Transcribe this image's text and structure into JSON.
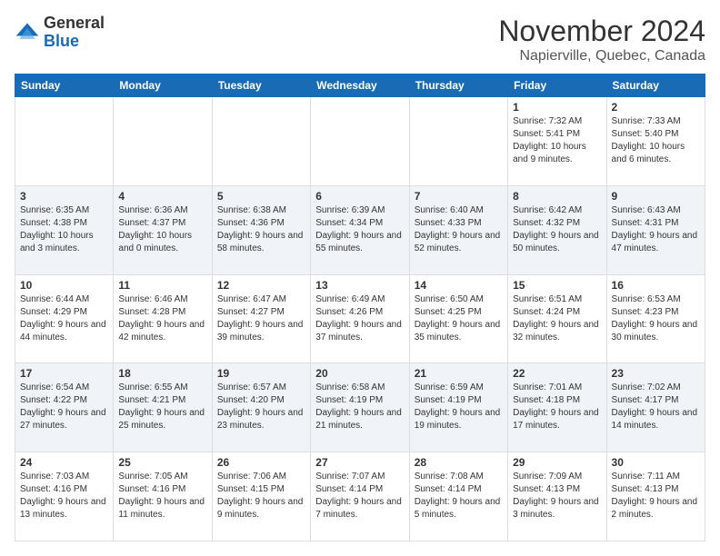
{
  "header": {
    "logo_line1": "General",
    "logo_line2": "Blue",
    "month_title": "November 2024",
    "location": "Napierville, Quebec, Canada"
  },
  "days_of_week": [
    "Sunday",
    "Monday",
    "Tuesday",
    "Wednesday",
    "Thursday",
    "Friday",
    "Saturday"
  ],
  "weeks": [
    [
      {
        "day": "",
        "info": ""
      },
      {
        "day": "",
        "info": ""
      },
      {
        "day": "",
        "info": ""
      },
      {
        "day": "",
        "info": ""
      },
      {
        "day": "",
        "info": ""
      },
      {
        "day": "1",
        "info": "Sunrise: 7:32 AM\nSunset: 5:41 PM\nDaylight: 10 hours and 9 minutes."
      },
      {
        "day": "2",
        "info": "Sunrise: 7:33 AM\nSunset: 5:40 PM\nDaylight: 10 hours and 6 minutes."
      }
    ],
    [
      {
        "day": "3",
        "info": "Sunrise: 6:35 AM\nSunset: 4:38 PM\nDaylight: 10 hours and 3 minutes."
      },
      {
        "day": "4",
        "info": "Sunrise: 6:36 AM\nSunset: 4:37 PM\nDaylight: 10 hours and 0 minutes."
      },
      {
        "day": "5",
        "info": "Sunrise: 6:38 AM\nSunset: 4:36 PM\nDaylight: 9 hours and 58 minutes."
      },
      {
        "day": "6",
        "info": "Sunrise: 6:39 AM\nSunset: 4:34 PM\nDaylight: 9 hours and 55 minutes."
      },
      {
        "day": "7",
        "info": "Sunrise: 6:40 AM\nSunset: 4:33 PM\nDaylight: 9 hours and 52 minutes."
      },
      {
        "day": "8",
        "info": "Sunrise: 6:42 AM\nSunset: 4:32 PM\nDaylight: 9 hours and 50 minutes."
      },
      {
        "day": "9",
        "info": "Sunrise: 6:43 AM\nSunset: 4:31 PM\nDaylight: 9 hours and 47 minutes."
      }
    ],
    [
      {
        "day": "10",
        "info": "Sunrise: 6:44 AM\nSunset: 4:29 PM\nDaylight: 9 hours and 44 minutes."
      },
      {
        "day": "11",
        "info": "Sunrise: 6:46 AM\nSunset: 4:28 PM\nDaylight: 9 hours and 42 minutes."
      },
      {
        "day": "12",
        "info": "Sunrise: 6:47 AM\nSunset: 4:27 PM\nDaylight: 9 hours and 39 minutes."
      },
      {
        "day": "13",
        "info": "Sunrise: 6:49 AM\nSunset: 4:26 PM\nDaylight: 9 hours and 37 minutes."
      },
      {
        "day": "14",
        "info": "Sunrise: 6:50 AM\nSunset: 4:25 PM\nDaylight: 9 hours and 35 minutes."
      },
      {
        "day": "15",
        "info": "Sunrise: 6:51 AM\nSunset: 4:24 PM\nDaylight: 9 hours and 32 minutes."
      },
      {
        "day": "16",
        "info": "Sunrise: 6:53 AM\nSunset: 4:23 PM\nDaylight: 9 hours and 30 minutes."
      }
    ],
    [
      {
        "day": "17",
        "info": "Sunrise: 6:54 AM\nSunset: 4:22 PM\nDaylight: 9 hours and 27 minutes."
      },
      {
        "day": "18",
        "info": "Sunrise: 6:55 AM\nSunset: 4:21 PM\nDaylight: 9 hours and 25 minutes."
      },
      {
        "day": "19",
        "info": "Sunrise: 6:57 AM\nSunset: 4:20 PM\nDaylight: 9 hours and 23 minutes."
      },
      {
        "day": "20",
        "info": "Sunrise: 6:58 AM\nSunset: 4:19 PM\nDaylight: 9 hours and 21 minutes."
      },
      {
        "day": "21",
        "info": "Sunrise: 6:59 AM\nSunset: 4:19 PM\nDaylight: 9 hours and 19 minutes."
      },
      {
        "day": "22",
        "info": "Sunrise: 7:01 AM\nSunset: 4:18 PM\nDaylight: 9 hours and 17 minutes."
      },
      {
        "day": "23",
        "info": "Sunrise: 7:02 AM\nSunset: 4:17 PM\nDaylight: 9 hours and 14 minutes."
      }
    ],
    [
      {
        "day": "24",
        "info": "Sunrise: 7:03 AM\nSunset: 4:16 PM\nDaylight: 9 hours and 13 minutes."
      },
      {
        "day": "25",
        "info": "Sunrise: 7:05 AM\nSunset: 4:16 PM\nDaylight: 9 hours and 11 minutes."
      },
      {
        "day": "26",
        "info": "Sunrise: 7:06 AM\nSunset: 4:15 PM\nDaylight: 9 hours and 9 minutes."
      },
      {
        "day": "27",
        "info": "Sunrise: 7:07 AM\nSunset: 4:14 PM\nDaylight: 9 hours and 7 minutes."
      },
      {
        "day": "28",
        "info": "Sunrise: 7:08 AM\nSunset: 4:14 PM\nDaylight: 9 hours and 5 minutes."
      },
      {
        "day": "29",
        "info": "Sunrise: 7:09 AM\nSunset: 4:13 PM\nDaylight: 9 hours and 3 minutes."
      },
      {
        "day": "30",
        "info": "Sunrise: 7:11 AM\nSunset: 4:13 PM\nDaylight: 9 hours and 2 minutes."
      }
    ]
  ]
}
